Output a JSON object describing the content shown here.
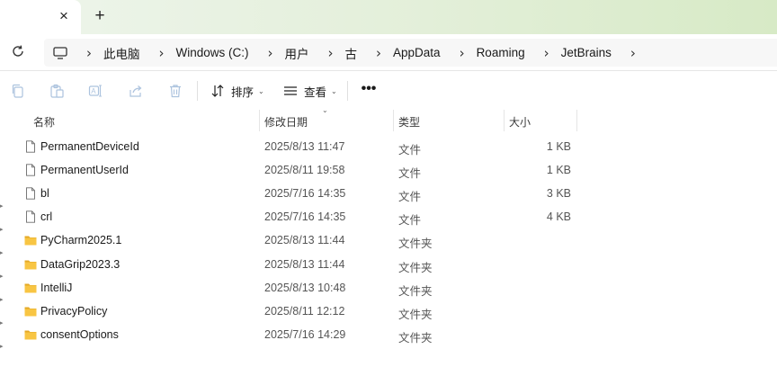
{
  "tabbar": {
    "close_glyph": "×",
    "new_tab_glyph": "+"
  },
  "address": {
    "separator": "›",
    "crumbs": [
      "此电脑",
      "Windows (C:)",
      "用户",
      "古",
      "AppData",
      "Roaming",
      "JetBrains"
    ]
  },
  "toolbar": {
    "sort_label": "排序",
    "view_label": "查看",
    "more_label": "•••",
    "caret": "⌄"
  },
  "columns": {
    "name": "名称",
    "date": "修改日期",
    "type": "类型",
    "size": "大小",
    "sort_indicator": "⌄"
  },
  "files": [
    {
      "name": "PermanentDeviceId",
      "date": "2025/8/13 11:47",
      "type": "文件",
      "size": "1 KB",
      "kind": "file"
    },
    {
      "name": "PermanentUserId",
      "date": "2025/8/11 19:58",
      "type": "文件",
      "size": "1 KB",
      "kind": "file"
    },
    {
      "name": "bl",
      "date": "2025/7/16 14:35",
      "type": "文件",
      "size": "3 KB",
      "kind": "file"
    },
    {
      "name": "crl",
      "date": "2025/7/16 14:35",
      "type": "文件",
      "size": "4 KB",
      "kind": "file"
    },
    {
      "name": "PyCharm2025.1",
      "date": "2025/8/13 11:44",
      "type": "文件夹",
      "size": "",
      "kind": "folder"
    },
    {
      "name": "DataGrip2023.3",
      "date": "2025/8/13 11:44",
      "type": "文件夹",
      "size": "",
      "kind": "folder"
    },
    {
      "name": "IntelliJ",
      "date": "2025/8/13 10:48",
      "type": "文件夹",
      "size": "",
      "kind": "folder"
    },
    {
      "name": "PrivacyPolicy",
      "date": "2025/8/11 12:12",
      "type": "文件夹",
      "size": "",
      "kind": "folder"
    },
    {
      "name": "consentOptions",
      "date": "2025/7/16 14:29",
      "type": "文件夹",
      "size": "",
      "kind": "folder"
    }
  ],
  "colors": {
    "folder": "#f8c543",
    "folder_dark": "#e4a926",
    "accent": "#0067c0"
  }
}
